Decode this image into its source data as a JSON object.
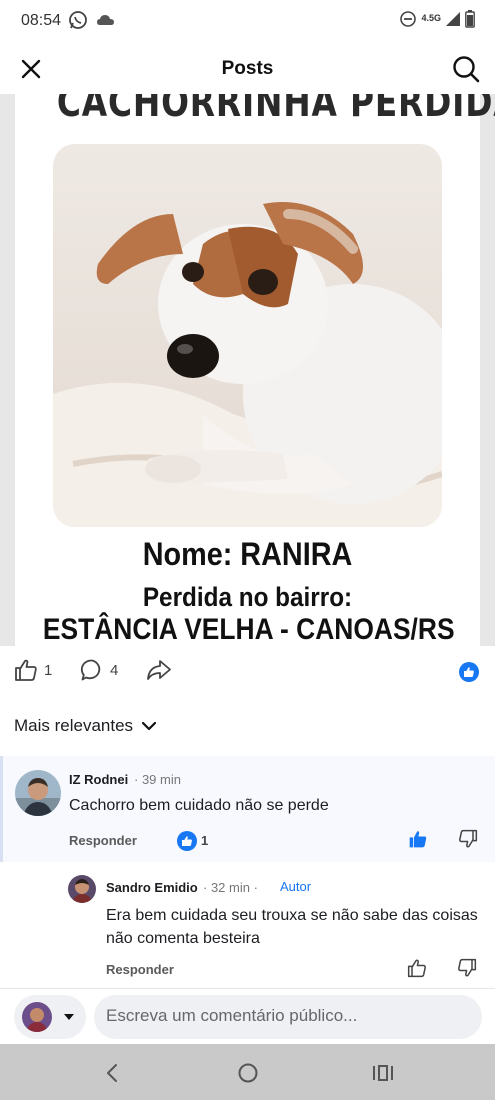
{
  "status_bar": {
    "time": "08:54",
    "network": "4.5G"
  },
  "header": {
    "title": "Posts"
  },
  "post": {
    "poster": {
      "headline": "CACHORRINHA PERDIDA",
      "name_line": "Nome: RANIRA",
      "lost_line": "Perdida no bairro:",
      "place_line": "ESTÂNCIA VELHA - CANOAS/RS"
    },
    "likes_count": "1",
    "comments_count": "4"
  },
  "comments_section": {
    "sort_label": "Mais relevantes",
    "comments": [
      {
        "author": "IZ Rodnei",
        "time": "· 39 min",
        "text": "Cachorro bem cuidado não se perde",
        "reply_label": "Responder",
        "reaction_count": "1"
      },
      {
        "author": "Sandro Emidio",
        "time": "· 32 min ·",
        "author_tag": "Autor",
        "text": "Era bem cuidada seu trouxa se não sabe das coisas não comenta besteira",
        "reply_label": "Responder"
      }
    ]
  },
  "composer": {
    "placeholder": "Escreva um comentário público..."
  },
  "colors": {
    "accent": "#1877f2",
    "nav_bar": "#c9c9c9"
  }
}
